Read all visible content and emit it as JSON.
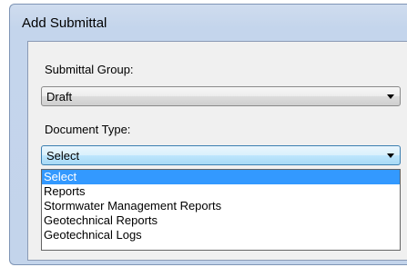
{
  "dialog": {
    "title": "Add Submittal"
  },
  "submittal_group": {
    "label": "Submittal Group:",
    "value": "Draft"
  },
  "document_type": {
    "label": "Document Type:",
    "value": "Select",
    "options": [
      "Select",
      "Reports",
      "Stormwater Management Reports",
      "Geotechnical Reports",
      "Geotechnical Logs"
    ]
  },
  "colors": {
    "highlight": "#3399ff",
    "title_bar": "#c4d5ec"
  }
}
